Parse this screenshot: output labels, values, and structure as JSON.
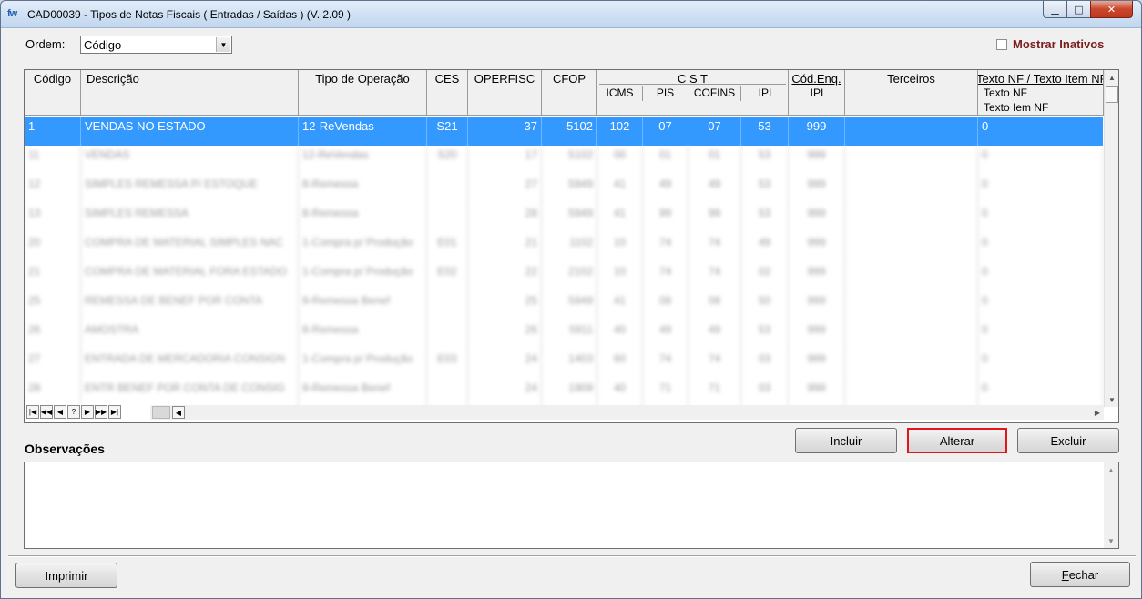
{
  "window": {
    "title": "CAD00039 - Tipos de Notas Fiscais ( Entradas / Saídas )  (V.  2.09 )",
    "app_icon": "fw",
    "controls": {
      "minimize": "▁",
      "maximize": "□",
      "close": "✕"
    }
  },
  "ordem": {
    "label": "Ordem:",
    "value": "Código"
  },
  "mostrar_inativos": {
    "label": "Mostrar Inativos",
    "checked": false
  },
  "grid": {
    "headers": {
      "codigo": "Código",
      "descricao": "Descrição",
      "tipo_operacao": "Tipo de Operação",
      "ces": "CES",
      "operfisc": "OPERFISC",
      "cfop": "CFOP",
      "cst": "C S T",
      "icms": "ICMS",
      "pis": "PIS",
      "cofins": "COFINS",
      "ipi": "IPI",
      "cod_enq": "Cód.Enq.",
      "cod_enq_ipi": "IPI",
      "terceiros": "Terceiros",
      "texto_nf": "Texto NF / Texto Item NF",
      "texto_nf_1": "Texto NF",
      "texto_nf_2": "Texto Iem NF"
    },
    "selected_row": {
      "codigo": "1",
      "descricao": "VENDAS NO ESTADO",
      "tipo_operacao": "12-ReVendas",
      "ces": "S21",
      "operfisc": "37",
      "cfop": "5102",
      "icms": "102",
      "pis": "07",
      "cofins": "07",
      "ipi": "53",
      "cod_enq": "999",
      "terceiros": "",
      "texto_nf": "0"
    },
    "blurred_rows": [
      {
        "codigo": "11",
        "descricao": "VENDAS",
        "tipo": "12-ReVendas",
        "ces": "S20",
        "operfisc": "17",
        "cfop": "5102",
        "icms": "00",
        "pis": "01",
        "cofins": "01",
        "ipi": "53",
        "enq": "999",
        "texto": "0"
      },
      {
        "codigo": "12",
        "descricao": "SIMPLES REMESSA P/ ESTOQUE",
        "tipo": "8-Remessa",
        "ces": "",
        "operfisc": "27",
        "cfop": "5949",
        "icms": "41",
        "pis": "49",
        "cofins": "49",
        "ipi": "53",
        "enq": "999",
        "texto": "0"
      },
      {
        "codigo": "13",
        "descricao": "SIMPLES REMESSA",
        "tipo": "8-Remessa",
        "ces": "",
        "operfisc": "28",
        "cfop": "5949",
        "icms": "41",
        "pis": "99",
        "cofins": "99",
        "ipi": "53",
        "enq": "999",
        "texto": "0"
      },
      {
        "codigo": "20",
        "descricao": "COMPRA DE MATERIAL SIMPLES NAC",
        "tipo": "1-Compra p/ Produção",
        "ces": "E01",
        "operfisc": "21",
        "cfop": "1102",
        "icms": "10",
        "pis": "74",
        "cofins": "74",
        "ipi": "49",
        "enq": "999",
        "texto": "0"
      },
      {
        "codigo": "21",
        "descricao": "COMPRA DE MATERIAL FORA ESTADO",
        "tipo": "1-Compra p/ Produção",
        "ces": "E02",
        "operfisc": "22",
        "cfop": "2102",
        "icms": "10",
        "pis": "74",
        "cofins": "74",
        "ipi": "02",
        "enq": "999",
        "texto": "0"
      },
      {
        "codigo": "25",
        "descricao": "REMESSA DE BENEF POR CONTA",
        "tipo": "9-Remessa Benef",
        "ces": "",
        "operfisc": "25",
        "cfop": "5949",
        "icms": "41",
        "pis": "08",
        "cofins": "08",
        "ipi": "50",
        "enq": "999",
        "texto": "0"
      },
      {
        "codigo": "26",
        "descricao": "AMOSTRA",
        "tipo": "8-Remessa",
        "ces": "",
        "operfisc": "26",
        "cfop": "5911",
        "icms": "40",
        "pis": "49",
        "cofins": "49",
        "ipi": "53",
        "enq": "999",
        "texto": "0"
      },
      {
        "codigo": "27",
        "descricao": "ENTRADA DE MERCADORIA CONSIGN",
        "tipo": "1-Compra p/ Produção",
        "ces": "E03",
        "operfisc": "24",
        "cfop": "1403",
        "icms": "60",
        "pis": "74",
        "cofins": "74",
        "ipi": "03",
        "enq": "999",
        "texto": "0"
      },
      {
        "codigo": "28",
        "descricao": "ENTR BENEF POR CONTA DE CONSIG",
        "tipo": "9-Remessa Benef",
        "ces": "",
        "operfisc": "24",
        "cfop": "1909",
        "icms": "40",
        "pis": "71",
        "cofins": "71",
        "ipi": "03",
        "enq": "999",
        "texto": "0"
      }
    ],
    "nav_buttons": [
      "|◀",
      "◀◀",
      "◀",
      "?",
      "▶",
      "▶▶",
      "▶|"
    ]
  },
  "buttons": {
    "incluir": "Incluir",
    "alterar": "Alterar",
    "excluir": "Excluir",
    "imprimir": "Imprimir",
    "fechar_first": "F",
    "fechar_rest": "echar"
  },
  "observacoes": {
    "label": "Observações",
    "text": ""
  },
  "colors": {
    "selection": "#3399ff",
    "highlight_border": "#e0161e",
    "inativos_label": "#7b1d1d"
  }
}
